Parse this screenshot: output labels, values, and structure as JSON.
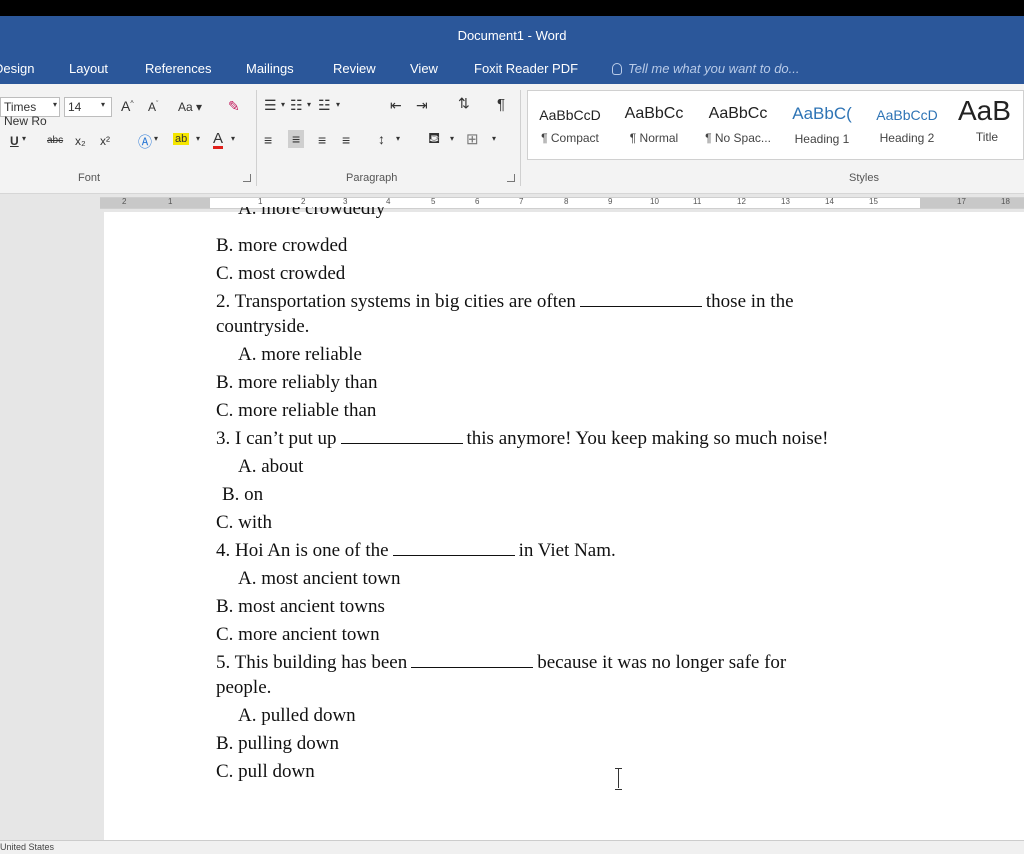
{
  "window": {
    "title": "Document1 - Word"
  },
  "tabs": [
    "Design",
    "Layout",
    "References",
    "Mailings",
    "Review",
    "View",
    "Foxit Reader PDF"
  ],
  "tell_me": "Tell me what you want to do...",
  "font": {
    "family": "Times New Ro",
    "size": "14",
    "grow": "A",
    "shrink": "A",
    "case": "Aa",
    "underline": "U",
    "strike": "abc",
    "subscript": "x₂",
    "superscript": "x²",
    "highlight": "ab",
    "font_color": "A"
  },
  "groups": {
    "font": "Font",
    "paragraph": "Paragraph",
    "styles": "Styles"
  },
  "styles": [
    {
      "sample": "AaBbCcD",
      "name": "¶ Compact"
    },
    {
      "sample": "AaBbCc",
      "name": "¶ Normal"
    },
    {
      "sample": "AaBbCc",
      "name": "¶ No Spac..."
    },
    {
      "sample": "AaBbC(",
      "name": "Heading 1"
    },
    {
      "sample": "AaBbCcD",
      "name": "Heading 2"
    },
    {
      "sample": "AaB",
      "name": "Title"
    }
  ],
  "ruler": [
    "2",
    "1",
    "1",
    "2",
    "3",
    "4",
    "5",
    "6",
    "7",
    "8",
    "9",
    "10",
    "11",
    "12",
    "13",
    "14",
    "15",
    "17",
    "18"
  ],
  "doc": {
    "cut_line": "A. more crowdedly",
    "q1": {
      "b": "B. more crowded",
      "c": "C. most crowded"
    },
    "q2": {
      "before": "2. Transportation systems in big cities are often",
      "after": "those in the",
      "cont": "countryside.",
      "a": "A. more reliable",
      "b": "B. more reliably than",
      "c": "C. more reliable than"
    },
    "q3": {
      "before": "3. I can’t put up",
      "after": "this anymore! You keep making so much noise!",
      "a": "A. about",
      "b": "B. on",
      "c": "C. with"
    },
    "q4": {
      "before": "4. Hoi An is one of the",
      "after": "in Viet Nam.",
      "a": "A. most ancient town",
      "b": "B. most ancient towns",
      "c": "C. more ancient town"
    },
    "q5": {
      "before": "5. This building has been",
      "after": "because it was no longer safe for",
      "cont": "people.",
      "a": "A. pulled down",
      "b": "B. pulling down",
      "c": "C. pull down"
    }
  },
  "status": {
    "language": "United States"
  },
  "colors": {
    "ribbon_blue": "#2b579a",
    "ribbon_bg": "#f3f3f3",
    "font_color_red": "#e0201b",
    "highlight_yellow": "#f5e600"
  }
}
